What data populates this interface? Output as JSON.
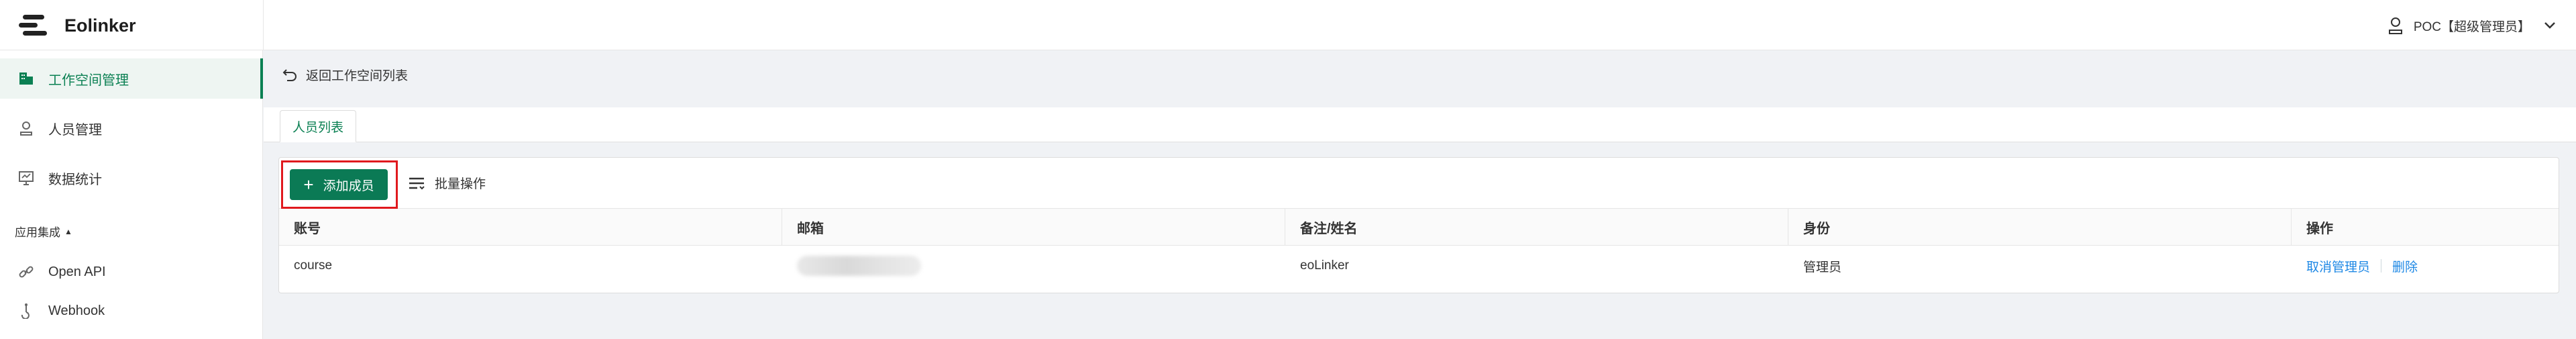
{
  "header": {
    "brand": "Eolinker",
    "user_label": "POC【超级管理员】"
  },
  "sidebar": {
    "items": [
      {
        "label": "工作空间管理",
        "icon": "building-icon",
        "active": true
      },
      {
        "label": "人员管理",
        "icon": "user-icon",
        "active": false
      },
      {
        "label": "数据统计",
        "icon": "monitor-chart-icon",
        "active": false
      }
    ],
    "group_title": "应用集成",
    "group_items": [
      {
        "label": "Open API",
        "icon": "link-icon"
      },
      {
        "label": "Webhook",
        "icon": "webhook-icon"
      }
    ]
  },
  "main": {
    "back_label": "返回工作空间列表",
    "tab_label": "人员列表",
    "toolbar": {
      "add_label": "添加成员",
      "batch_label": "批量操作"
    },
    "table": {
      "headers": [
        "账号",
        "邮箱",
        "备注/姓名",
        "身份",
        "操作"
      ],
      "rows": [
        {
          "account": "course",
          "remark": "eoLinker",
          "role": "管理员",
          "actions": [
            "取消管理员",
            "删除"
          ]
        }
      ]
    }
  },
  "colors": {
    "accent": "#0b8053",
    "highlight_box": "#e0191e",
    "link": "#1e88e5"
  }
}
